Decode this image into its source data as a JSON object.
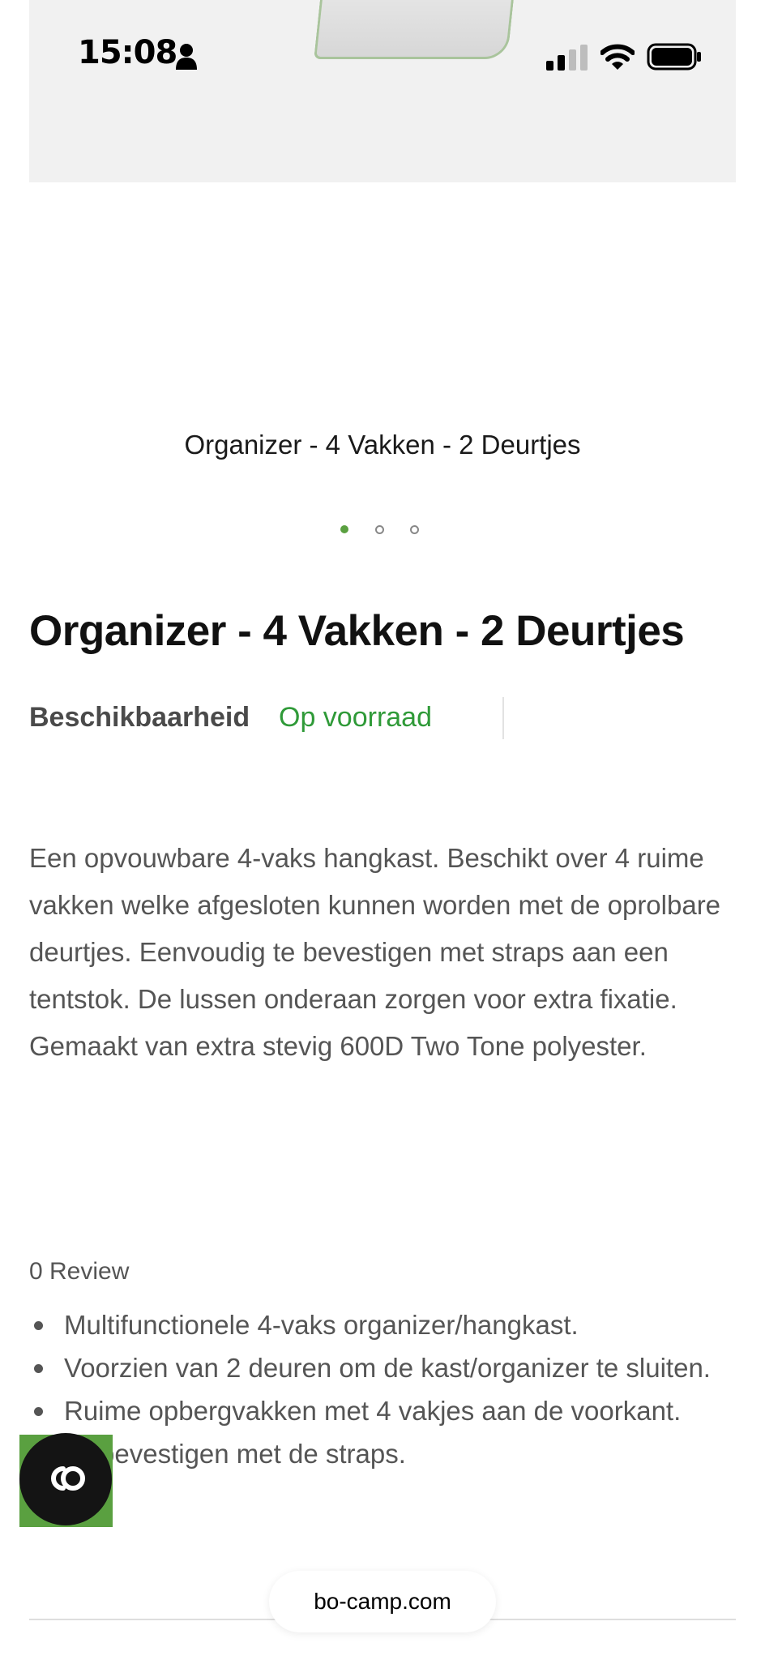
{
  "status_bar": {
    "time": "15:08"
  },
  "gallery": {
    "caption": "Organizer - 4 Vakken - 2 Deurtjes",
    "active_dot": 1,
    "dot_count": 3
  },
  "product": {
    "title": "Organizer - 4 Vakken - 2 Deurtjes",
    "availability_label": "Beschikbaarheid",
    "availability_value": "Op voorraad",
    "description": "Een opvouwbare 4-vaks hangkast. Beschikt over 4 ruime vakken welke afgesloten kunnen worden met de oprolbare deurtjes. Eenvoudig te bevestigen met straps aan een tentstok. De lussen onderaan zorgen voor extra fixatie. Gemaakt van extra stevig 600D Two Tone polyester.",
    "reviews": "0 Review",
    "features": [
      "Multifunctionele 4-vaks organizer/hangkast.",
      "Voorzien van 2 deuren om de kast/organizer te sluiten.",
      "Ruime opbergvakken met 4 vakjes aan de voorkant.",
      "Te bevestigen met de straps."
    ]
  },
  "browser": {
    "url": "bo-camp.com"
  },
  "colors": {
    "accent_green": "#5aa040",
    "stock_green": "#2f9a38",
    "text_gray": "#555555"
  }
}
